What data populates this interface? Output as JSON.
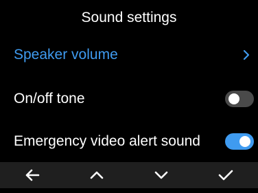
{
  "header": {
    "title": "Sound settings"
  },
  "settings": [
    {
      "label": "Speaker volume",
      "type": "link",
      "selected": true,
      "icon": "chevron-right-icon"
    },
    {
      "label": "On/off tone",
      "type": "toggle",
      "state": "off"
    },
    {
      "label": "Emergency video alert sound",
      "type": "toggle",
      "state": "on"
    }
  ],
  "bottom_nav": {
    "buttons": [
      {
        "name": "back",
        "icon": "arrow-left-icon"
      },
      {
        "name": "up",
        "icon": "chevron-up-icon"
      },
      {
        "name": "down",
        "icon": "chevron-down-icon"
      },
      {
        "name": "confirm",
        "icon": "checkmark-icon"
      }
    ]
  },
  "colors": {
    "background": "#000000",
    "accent": "#3f9bf0",
    "toggle_off": "#4a4a4a",
    "bottom_bar": "#1f1f1f",
    "text": "#ffffff"
  }
}
